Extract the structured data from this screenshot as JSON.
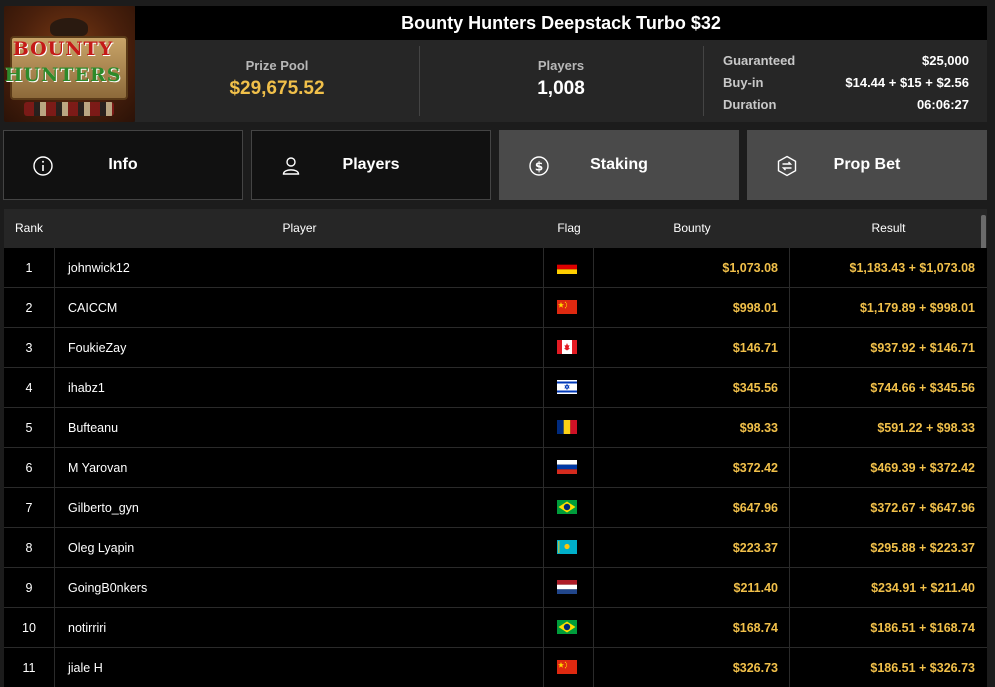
{
  "tournament": {
    "title": "Bounty Hunters Deepstack Turbo $32",
    "logo_text_top": "BOUNTY",
    "logo_text_bottom": "HUNTERS"
  },
  "stats": {
    "prize_pool_label": "Prize Pool",
    "prize_pool_value": "$29,675.52",
    "players_label": "Players",
    "players_value": "1,008",
    "details": [
      {
        "key": "Guaranteed",
        "value": "$25,000"
      },
      {
        "key": "Buy-in",
        "value": "$14.44 + $15 + $2.56"
      },
      {
        "key": "Duration",
        "value": "06:06:27"
      }
    ]
  },
  "tabs": [
    {
      "label": "Info",
      "icon": "info-icon",
      "active": false
    },
    {
      "label": "Players",
      "icon": "user-icon",
      "active": false
    },
    {
      "label": "Staking",
      "icon": "dollar-coin-icon",
      "active": true
    },
    {
      "label": "Prop Bet",
      "icon": "prop-bet-icon",
      "active": false
    }
  ],
  "table": {
    "headers": {
      "rank": "Rank",
      "player": "Player",
      "flag": "Flag",
      "bounty": "Bounty",
      "result": "Result"
    },
    "rows": [
      {
        "rank": "1",
        "player": "johnwick12",
        "flag": "germany-flag-icon",
        "bounty": "$1,073.08",
        "result": "$1,183.43 + $1,073.08"
      },
      {
        "rank": "2",
        "player": "CAICCM",
        "flag": "china-flag-icon",
        "bounty": "$998.01",
        "result": "$1,179.89 + $998.01"
      },
      {
        "rank": "3",
        "player": "FoukieZay",
        "flag": "canada-flag-icon",
        "bounty": "$146.71",
        "result": "$937.92 + $146.71"
      },
      {
        "rank": "4",
        "player": "ihabz1",
        "flag": "israel-flag-icon",
        "bounty": "$345.56",
        "result": "$744.66 + $345.56"
      },
      {
        "rank": "5",
        "player": "Bufteanu",
        "flag": "romania-flag-icon",
        "bounty": "$98.33",
        "result": "$591.22 + $98.33"
      },
      {
        "rank": "6",
        "player": "M Yarovan",
        "flag": "russia-flag-icon",
        "bounty": "$372.42",
        "result": "$469.39 + $372.42"
      },
      {
        "rank": "7",
        "player": "Gilberto_gyn",
        "flag": "brazil-flag-icon",
        "bounty": "$647.96",
        "result": "$372.67 + $647.96"
      },
      {
        "rank": "8",
        "player": "Oleg Lyapin",
        "flag": "kazakhstan-flag-icon",
        "bounty": "$223.37",
        "result": "$295.88 + $223.37"
      },
      {
        "rank": "9",
        "player": "GoingB0nkers",
        "flag": "netherlands-flag-icon",
        "bounty": "$211.40",
        "result": "$234.91 + $211.40"
      },
      {
        "rank": "10",
        "player": "notirriri",
        "flag": "brazil-flag-icon",
        "bounty": "$168.74",
        "result": "$186.51 + $168.74"
      },
      {
        "rank": "11",
        "player": "jiale H",
        "flag": "china-flag-icon",
        "bounty": "$326.73",
        "result": "$186.51 + $326.73"
      }
    ]
  },
  "colors": {
    "accent_gold": "#f1c04a",
    "active_tab": "#4a4a4a",
    "panel": "#262626"
  }
}
